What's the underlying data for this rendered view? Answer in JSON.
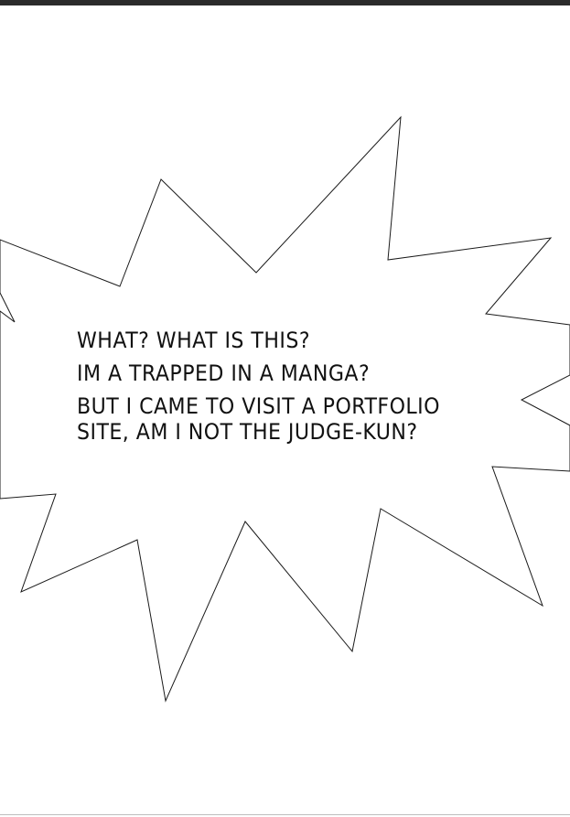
{
  "speech_bubble": {
    "lines": [
      "WHAT? WHAT IS THIS?",
      "IM A TRAPPED IN A MANGA?",
      "BUT I CAME TO VISIT A PORTFOLIO SITE, AM I NOT THE JUDGE-KUN?"
    ]
  },
  "colors": {
    "top_bar": "#2b2b2b",
    "outline": "#1a1a1a",
    "text": "#111111",
    "background": "#ffffff"
  }
}
